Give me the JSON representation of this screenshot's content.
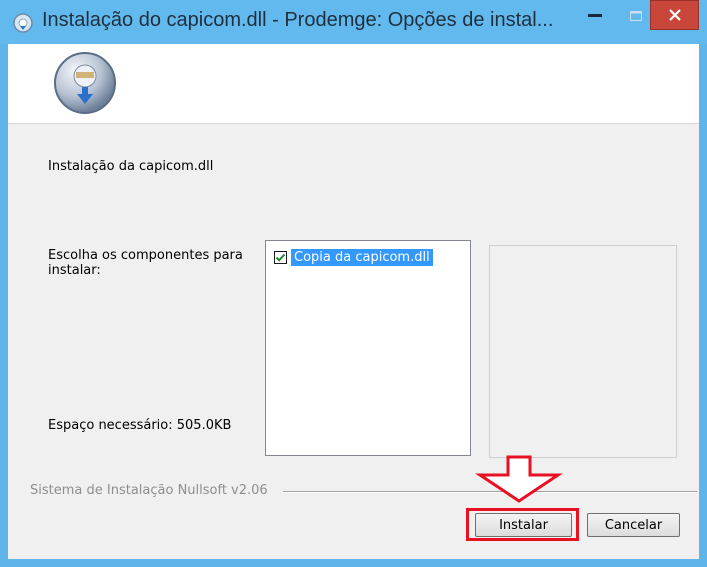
{
  "window": {
    "title": "Instalação do capicom.dll - Prodemge: Opções de instal..."
  },
  "content": {
    "intro": "Instalação da capicom.dll",
    "choose_label": "Escolha os componentes para instalar:",
    "space_label": "Espaço necessário: 505.0KB",
    "components": [
      {
        "label": "Copia da capicom.dll",
        "checked": true
      }
    ]
  },
  "footer": {
    "brand": "Sistema de Instalação Nullsoft v2.06",
    "install_label": "Instalar",
    "cancel_label": "Cancelar"
  },
  "colors": {
    "titlebar": "#62b9ee",
    "close_button": "#c9463a",
    "selection": "#3399ff",
    "annotation": "#e81123"
  },
  "icons": {
    "title": "installer-icon",
    "header": "nsis-logo-icon",
    "annotation": "red-down-arrow-icon"
  }
}
